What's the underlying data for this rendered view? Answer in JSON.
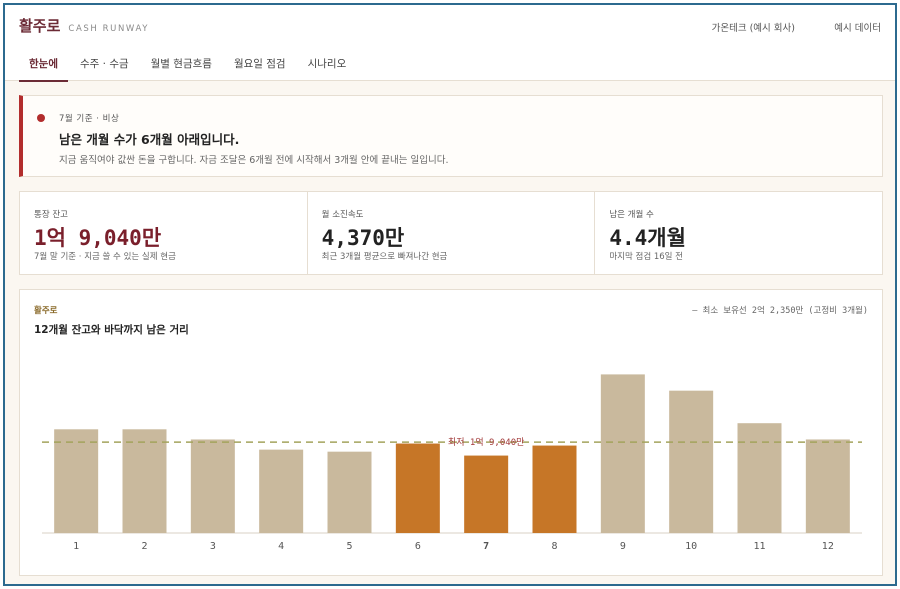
{
  "header": {
    "title": "활주로",
    "subtitle": "CASH RUNWAY",
    "company": "가온테크 (예시 회사)",
    "demo_label": "예시 데이터"
  },
  "tabs": [
    {
      "label": "한눈에",
      "active": true
    },
    {
      "label": "수주 · 수금",
      "active": false
    },
    {
      "label": "월별 현금흐름",
      "active": false
    },
    {
      "label": "월요일 점검",
      "active": false
    },
    {
      "label": "시나리오",
      "active": false
    }
  ],
  "alert": {
    "meta": "7월 기준 · 비상",
    "title": "남은 개월 수가 6개월 아래입니다.",
    "description": "지금 움직여야 값싼 돈을 구합니다. 자금 조달은 6개월 전에 시작해서 3개월 안에 끝내는 일입니다.",
    "color": "#b22d2d"
  },
  "kpis": [
    {
      "label": "통장 잔고",
      "value": "1억 9,040만",
      "note": "7월 말 기준 · 지금 쓸 수 있는 실제 현금",
      "danger": true
    },
    {
      "label": "월 소진속도",
      "value": "4,370만",
      "note": "최근 3개월 평균으로 빠져나간 현금",
      "danger": false
    },
    {
      "label": "남은 개월 수",
      "value": "4.4개월",
      "note": "마지막 점검 16일 전",
      "danger": false
    }
  ],
  "chart": {
    "kicker": "활주로",
    "title": "12개월 잔고와 바닥까지 남은 거리",
    "legend": "— 최소 보유선 2억 2,350만 (고정비 3개월)",
    "min_label": "최저 1억 9,040만",
    "current_month": "7"
  },
  "chart_data": {
    "type": "bar",
    "categories": [
      "1",
      "2",
      "3",
      "4",
      "5",
      "6",
      "7",
      "8",
      "9",
      "10",
      "11",
      "12"
    ],
    "values": [
      2.55,
      2.55,
      2.3,
      2.05,
      2.0,
      2.2,
      1.904,
      2.15,
      3.9,
      3.5,
      2.7,
      2.3
    ],
    "below_threshold": [
      false,
      false,
      false,
      false,
      false,
      true,
      true,
      true,
      false,
      false,
      false,
      false
    ],
    "threshold": 2.235,
    "unit": "억",
    "ylim": [
      0,
      4.5
    ],
    "colors": {
      "normal": "#c9b99d",
      "below": "#c67627",
      "threshold_line": "#a3a35c",
      "min_label": "#a23a3a"
    },
    "grid": false
  }
}
